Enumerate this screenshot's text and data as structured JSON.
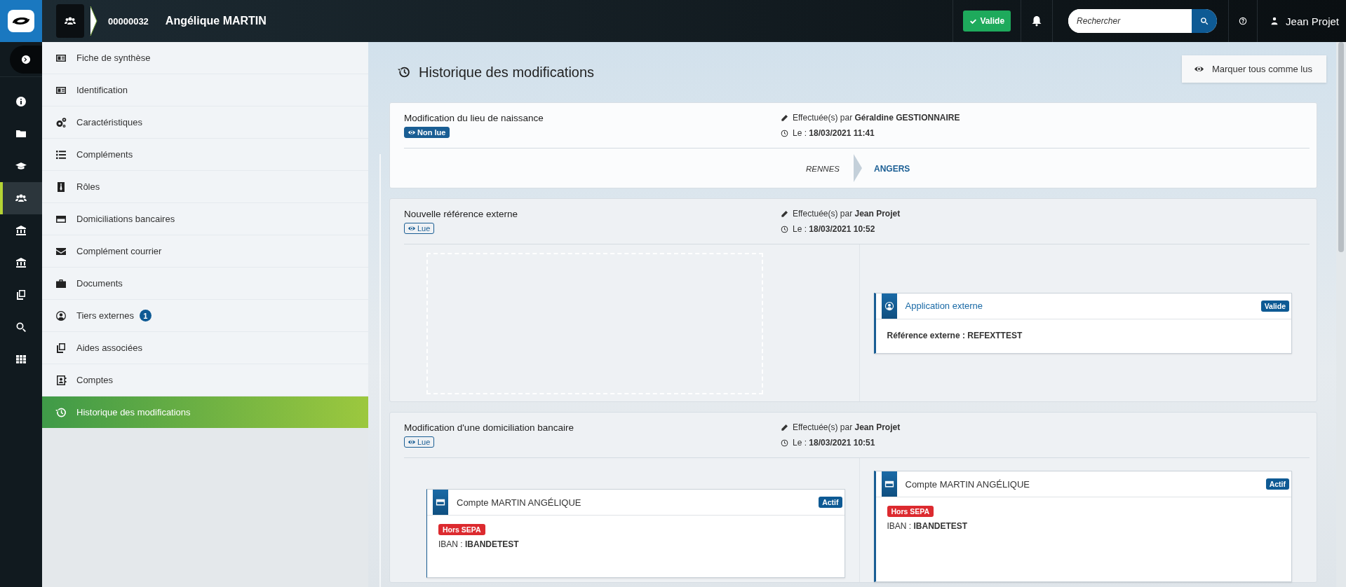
{
  "header": {
    "record_number": "00000032",
    "person_name": "Angélique MARTIN",
    "status": "Valide",
    "search": {
      "placeholder": "Rechercher"
    },
    "user": "Jean Projet"
  },
  "rail": [
    {
      "kind": "toggle",
      "selected": false
    },
    {
      "kind": "info",
      "selected": false
    },
    {
      "kind": "folder",
      "selected": false
    },
    {
      "kind": "cap",
      "selected": false
    },
    {
      "kind": "users",
      "selected": true
    },
    {
      "kind": "bank",
      "selected": false
    },
    {
      "kind": "bank",
      "selected": false
    },
    {
      "kind": "copies",
      "selected": false
    },
    {
      "kind": "search",
      "selected": false
    },
    {
      "kind": "grid",
      "selected": false
    }
  ],
  "sidebar": {
    "items": [
      {
        "kind": "idcard",
        "label": "Fiche de synthèse",
        "selected": false
      },
      {
        "kind": "idcard",
        "label": "Identification",
        "selected": false
      },
      {
        "kind": "gears",
        "label": "Caractéristiques",
        "selected": false
      },
      {
        "kind": "list",
        "label": "Compléments",
        "selected": false
      },
      {
        "kind": "tie",
        "label": "Rôles",
        "selected": false
      },
      {
        "kind": "card",
        "label": "Domiciliations bancaires",
        "selected": false
      },
      {
        "kind": "envelope",
        "label": "Complément courrier",
        "selected": false
      },
      {
        "kind": "briefcase",
        "label": "Documents",
        "selected": false
      },
      {
        "kind": "usercircle",
        "label": "Tiers externes",
        "badge": "1",
        "selected": false
      },
      {
        "kind": "copies",
        "label": "Aides associées",
        "selected": false
      },
      {
        "kind": "contact",
        "label": "Comptes",
        "selected": false
      },
      {
        "kind": "history",
        "label": "Historique des modifications",
        "selected": true
      }
    ]
  },
  "page": {
    "title": "Historique des modifications",
    "mark_all_button": "Marquer tous comme lus"
  },
  "changes": [
    {
      "kind": "value",
      "title": "Modification du lieu de naissance",
      "read": false,
      "read_label": "Non lue",
      "by_label": "Effectuée(s) par",
      "author": "Géraldine GESTIONNAIRE",
      "date_label": "Le :",
      "date": "18/03/2021 11:41",
      "before": "RENNES",
      "after": "ANGERS"
    },
    {
      "kind": "card",
      "title": "Nouvelle référence externe",
      "read": true,
      "read_label": "Lue",
      "by_label": "Effectuée(s) par",
      "author": "Jean Projet",
      "date_label": "Le :",
      "date": "18/03/2021 10:52",
      "after": {
        "kind": "app",
        "title": "Application externe",
        "status": "Valide",
        "lines": [
          {
            "text": "Référence externe : REFEXTTEST",
            "strong": true
          }
        ]
      }
    },
    {
      "kind": "card",
      "title": "Modification d'une domiciliation bancaire",
      "read": true,
      "read_label": "Lue",
      "by_label": "Effectuée(s) par",
      "author": "Jean Projet",
      "date_label": "Le :",
      "date": "18/03/2021 10:51",
      "before": {
        "kind": "account",
        "title": "Compte MARTIN ANGÉLIQUE",
        "status": "Actif",
        "tag": "Hors SEPA",
        "lines": [
          {
            "text": "IBAN : **IBANDETEST**",
            "strong": false
          }
        ]
      },
      "after": {
        "kind": "account",
        "title": "Compte MARTIN ANGÉLIQUE",
        "status": "Actif",
        "tag": "Hors SEPA",
        "lines": [
          {
            "text": "IBAN : **IBANDETEST**",
            "strong": false
          }
        ]
      }
    }
  ]
}
